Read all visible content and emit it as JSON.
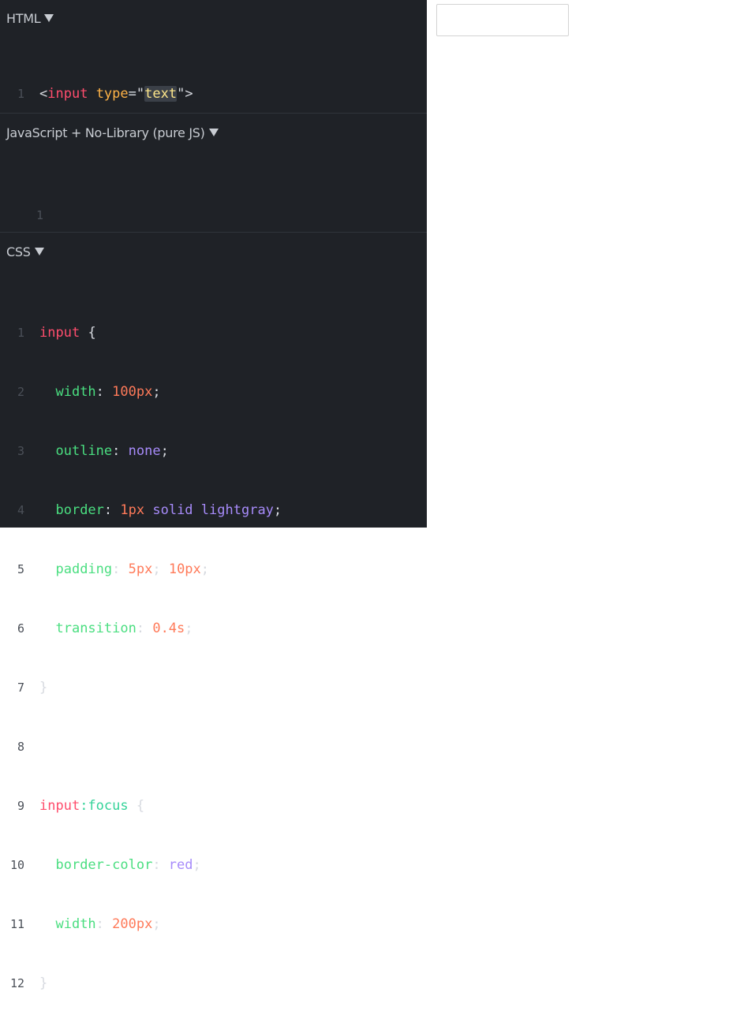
{
  "panels": {
    "html": {
      "title": "HTML"
    },
    "js": {
      "title": "JavaScript + No-Library (pure JS)"
    },
    "css": {
      "title": "CSS"
    }
  },
  "html_code": {
    "line_numbers": [
      "1"
    ],
    "line1": {
      "open": "<",
      "tag": "input",
      "sp": " ",
      "attr": "type",
      "eq": "=",
      "q1": "\"",
      "val": "text",
      "q2": "\"",
      "close": ">"
    }
  },
  "js_code": {
    "line_numbers": [
      "1"
    ]
  },
  "css_code": {
    "line_numbers": [
      "1",
      "2",
      "3",
      "4",
      "5",
      "6",
      "7",
      "8",
      "9",
      "10",
      "11",
      "12"
    ],
    "rule1_selector": "input",
    "brace_open": "{",
    "brace_close": "}",
    "width_prop": "width",
    "width_val": "100px",
    "outline_prop": "outline",
    "outline_val": "none",
    "border_prop": "border",
    "border_val_num": "1px",
    "border_val_style": "solid",
    "border_val_color": "lightgray",
    "padding_prop": "padding",
    "padding_val1": "5px",
    "padding_val2": "10px",
    "transition_prop": "transition",
    "transition_val": "0.4s",
    "rule2_selector": "input",
    "rule2_pseudo": ":focus",
    "border_color_prop": "border-color",
    "border_color_val": "red",
    "width2_prop": "width",
    "width2_val": "200px"
  },
  "preview": {
    "input_value": ""
  },
  "colors": {
    "editor_bg": "#1f2227",
    "tag": "#ff4d6d",
    "attribute": "#ffb347",
    "string": "#fde68a",
    "property": "#4ade80",
    "number": "#ff7a59",
    "keyword": "#a78bfa",
    "pseudo": "#34d399"
  },
  "icons": {
    "collapse": "caret-down-icon"
  }
}
